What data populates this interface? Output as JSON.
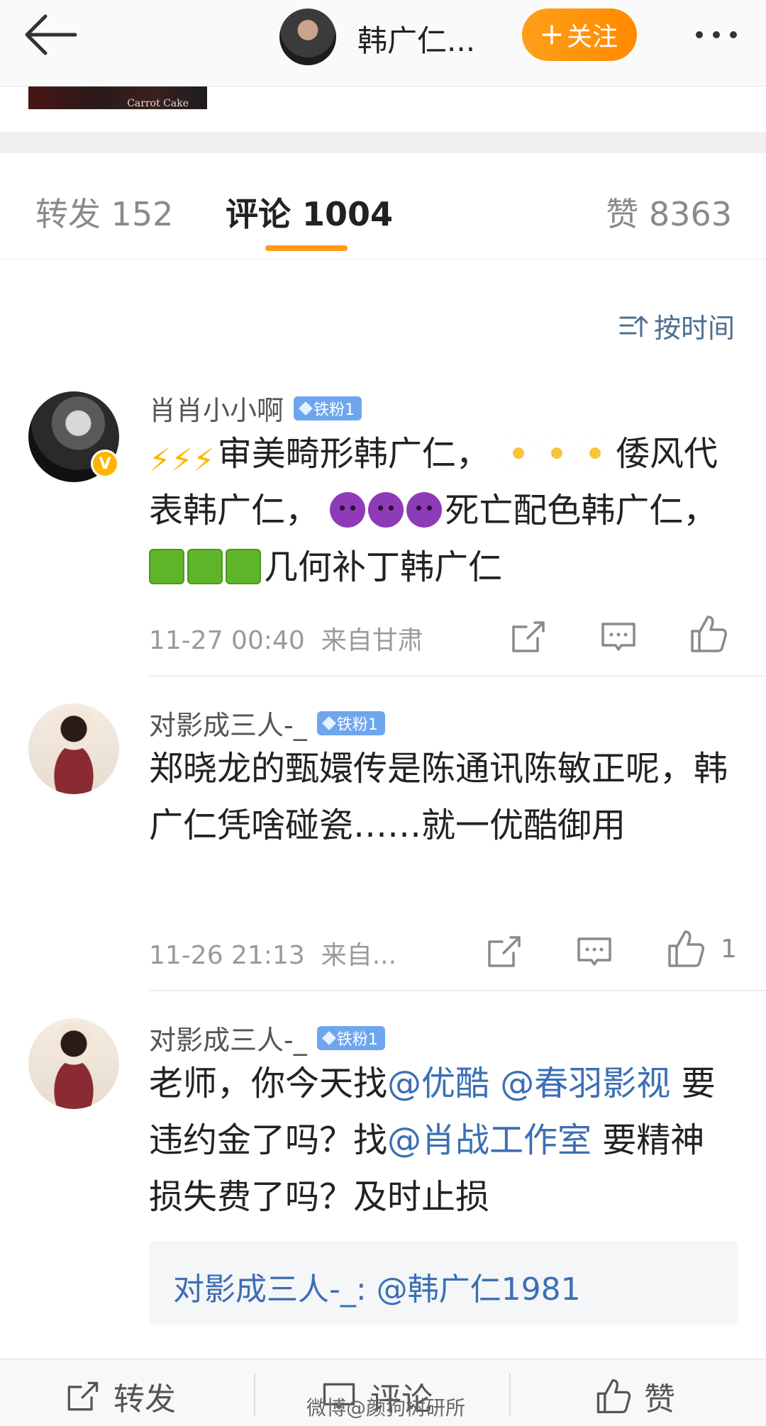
{
  "header": {
    "title": "韩广仁...",
    "follow_label": "关注"
  },
  "post_peek": {
    "image_caption": "Carrot Cake"
  },
  "tabs": {
    "repost": "转发 152",
    "comment": "评论 1004",
    "like": "赞 8363"
  },
  "sort_label": "按时间",
  "comments": [
    {
      "username": "肖肖小小啊",
      "badge": "铁粉1",
      "verified_badge": "V",
      "text_parts": [
        "审美畸形韩广仁，",
        "倭风代表韩广仁，",
        "死亡配色韩广仁，",
        "几何补丁韩广仁"
      ],
      "emoji_names": [
        "lightning-emoji",
        "daisy-emoji",
        "devil-emoji",
        "green-square-emoji"
      ],
      "time": "11-27 00:40",
      "location": "来自甘肃",
      "like_count": ""
    },
    {
      "username": "对影成三人-_",
      "badge": "铁粉1",
      "text": "郑晓龙的甄嬛传是陈通讯陈敏正呢，韩广仁凭啥碰瓷……就一优酷御用",
      "time": "11-26 21:13",
      "location": "来自...",
      "like_count": "1"
    },
    {
      "username": "对影成三人-_",
      "badge": "铁粉1",
      "text_before": "老师，你今天找",
      "mention_1": "@优酷",
      "mention_2": "@春羽影视",
      "text_mid": "要违约金了吗？找",
      "mention_3": "@肖战工作室",
      "text_after": "要精神损失费了吗？及时止损",
      "quote": "对影成三人-_: @韩广仁1981"
    }
  ],
  "bottom_bar": {
    "repost": "转发",
    "comment": "评论",
    "like": "赞"
  },
  "watermark": "微博@颜狗树研所",
  "colors": {
    "accent_orange": "#ff9a1a",
    "link_blue": "#3c6fb4",
    "sort_blue": "#4e6f91",
    "fan_badge": "#6ea6ee"
  }
}
